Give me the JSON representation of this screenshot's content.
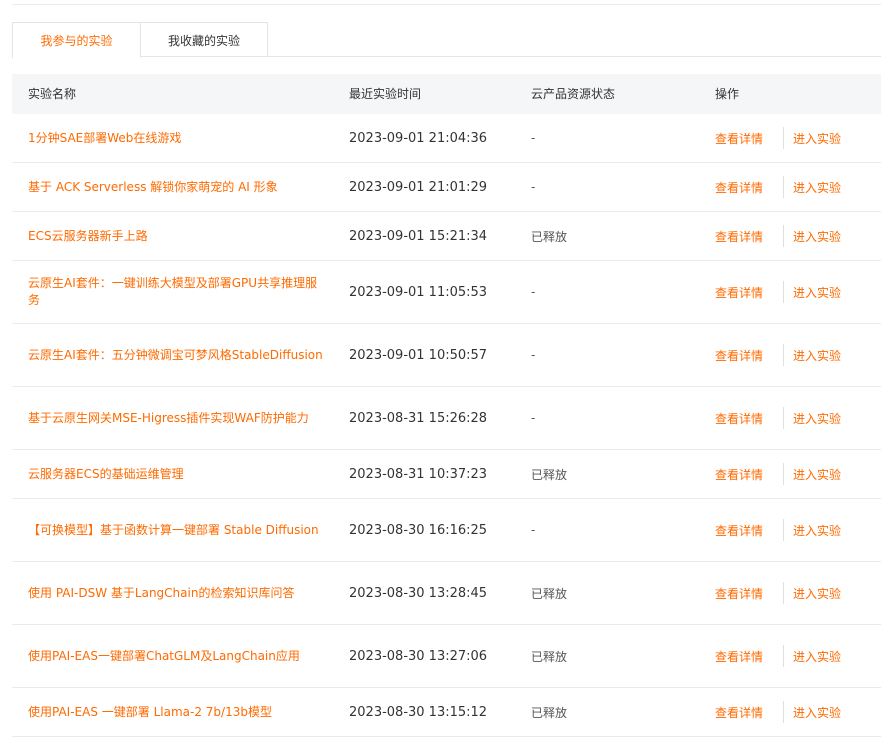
{
  "tabs": [
    {
      "label": "我参与的实验",
      "active": true
    },
    {
      "label": "我收藏的实验",
      "active": false
    }
  ],
  "table": {
    "headers": {
      "name": "实验名称",
      "time": "最近实验时间",
      "status": "云产品资源状态",
      "ops": "操作"
    },
    "rows": [
      {
        "name": "1分钟SAE部署Web在线游戏",
        "time": "2023-09-01 21:04:36",
        "status": "-",
        "detail": "查看详情",
        "enter": "进入实验"
      },
      {
        "name": "基于 ACK Serverless 解锁你家萌宠的 AI 形象",
        "time": "2023-09-01 21:01:29",
        "status": "-",
        "detail": "查看详情",
        "enter": "进入实验"
      },
      {
        "name": "ECS云服务器新手上路",
        "time": "2023-09-01 15:21:34",
        "status": "已释放",
        "detail": "查看详情",
        "enter": "进入实验"
      },
      {
        "name": "云原生AI套件：一键训练大模型及部署GPU共享推理服务",
        "time": "2023-09-01 11:05:53",
        "status": "-",
        "detail": "查看详情",
        "enter": "进入实验"
      },
      {
        "name": "云原生AI套件：五分钟微调宝可梦风格StableDiffusion",
        "time": "2023-09-01 10:50:57",
        "status": "-",
        "detail": "查看详情",
        "enter": "进入实验"
      },
      {
        "name": "基于云原生网关MSE-Higress插件实现WAF防护能力",
        "time": "2023-08-31 15:26:28",
        "status": "-",
        "detail": "查看详情",
        "enter": "进入实验"
      },
      {
        "name": "云服务器ECS的基础运维管理",
        "time": "2023-08-31 10:37:23",
        "status": "已释放",
        "detail": "查看详情",
        "enter": "进入实验"
      },
      {
        "name": "【可换模型】基于函数计算一键部署 Stable Diffusion",
        "time": "2023-08-30 16:16:25",
        "status": "-",
        "detail": "查看详情",
        "enter": "进入实验"
      },
      {
        "name": "使用 PAI-DSW 基于LangChain的检索知识库问答",
        "time": "2023-08-30 13:28:45",
        "status": "已释放",
        "detail": "查看详情",
        "enter": "进入实验"
      },
      {
        "name": "使用PAI-EAS一键部署ChatGLM及LangChain应用",
        "time": "2023-08-30 13:27:06",
        "status": "已释放",
        "detail": "查看详情",
        "enter": "进入实验"
      },
      {
        "name": "使用PAI-EAS 一键部署 Llama-2 7b/13b模型",
        "time": "2023-08-30 13:15:12",
        "status": "已释放",
        "detail": "查看详情",
        "enter": "进入实验"
      }
    ]
  },
  "colors": {
    "accent": "#ff6a00",
    "header_bg": "#f5f6f7"
  }
}
